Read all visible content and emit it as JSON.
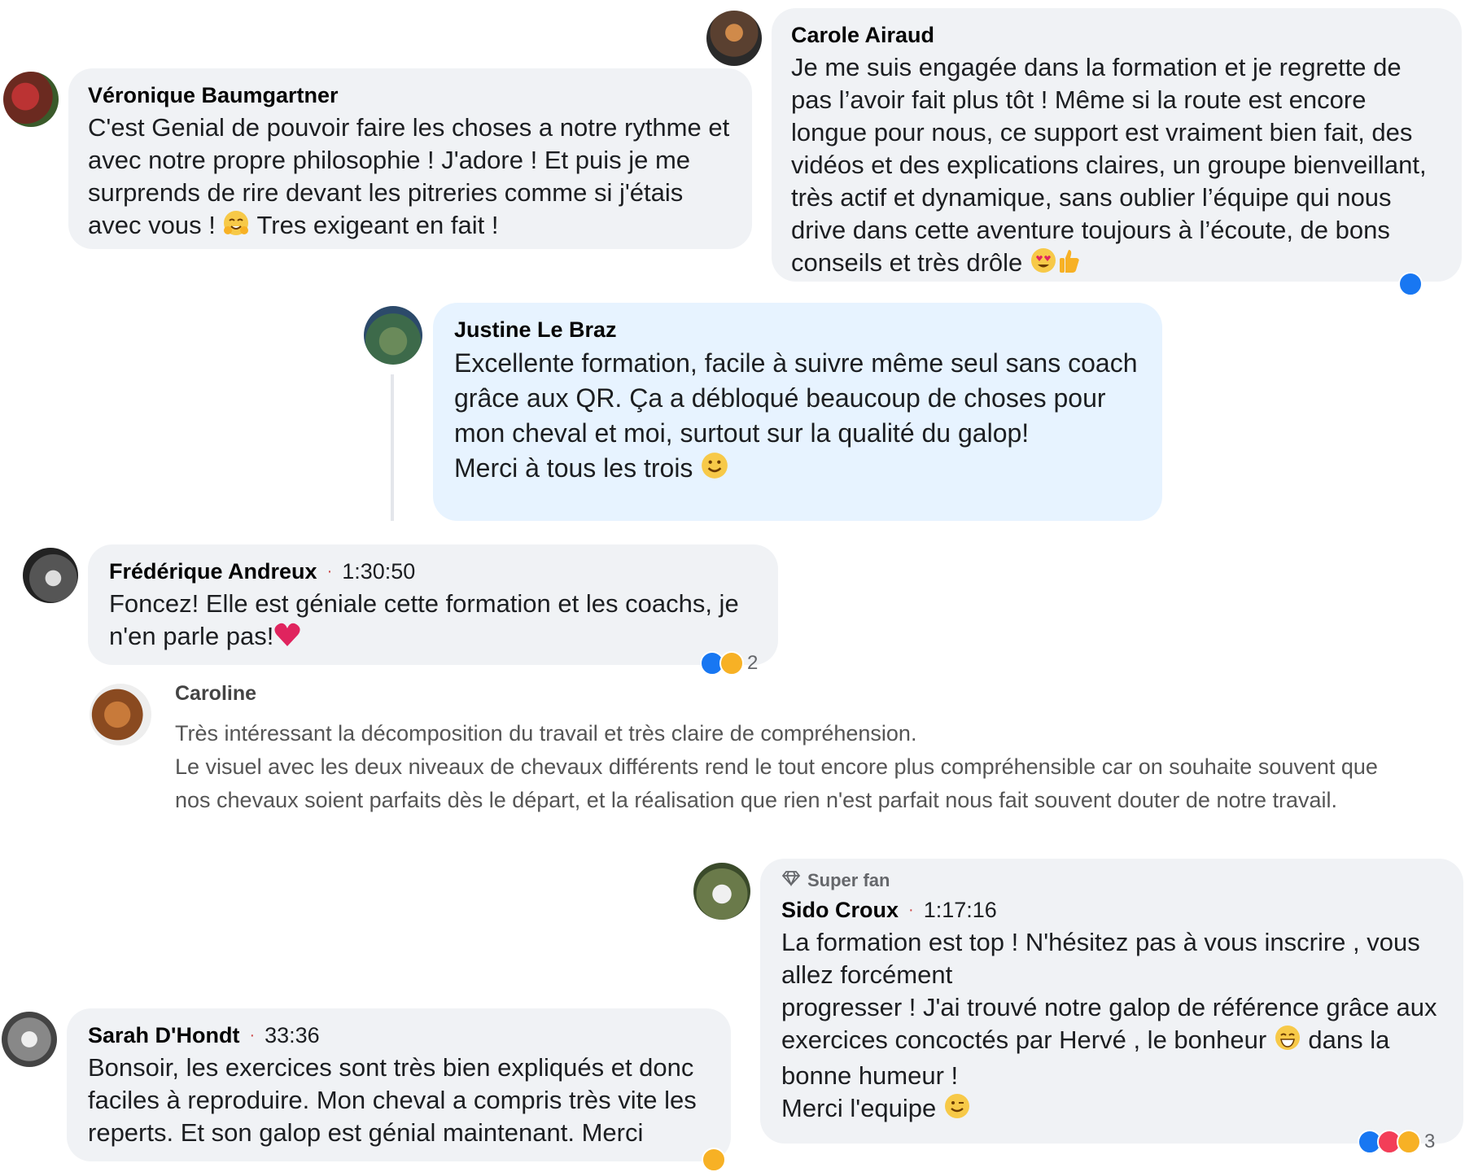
{
  "comments": [
    {
      "author": "Véronique Baumgartner",
      "text": "C'est Genial de pouvoir faire les choses a notre rythme et avec notre propre philosophie ! J'adore ! Et puis je me surprends de rire devant les pitreries comme si j'étais avec vous ! ",
      "text_end": " Tres exigeant en fait !",
      "emoji": "hugging-face"
    },
    {
      "author": "Carole Airaud",
      "text": "Je me suis engagée dans la formation et je regrette de pas l’avoir fait plus tôt ! Même si la route est encore longue pour nous, ce support est vraiment bien fait, des vidéos et des explications claires, un groupe bienveillant, très actif et dynamique, sans oublier l’équipe qui nous drive dans cette aventure toujours à l’écoute, de bons conseils et très drôle ",
      "emoji": "heart-eyes, thumbs-up"
    },
    {
      "author": "Justine Le Braz",
      "text": "Excellente formation, facile à suivre même seul sans coach grâce aux QR. Ça a débloqué beaucoup de choses pour mon cheval et moi, surtout sur la qualité du galop!",
      "text2": "Merci à tous les trois ",
      "emoji": "smile"
    },
    {
      "author": "Frédérique Andreux",
      "time": "1:30:50",
      "text": "Foncez! Elle est géniale cette formation et les coachs, je n'en parle pas!",
      "emoji": "red-heart",
      "reactions": "2"
    },
    {
      "author": "Caroline",
      "text": "Très intéressant la décomposition du travail et très claire de compréhension.",
      "text2": "Le visuel avec les deux niveaux de chevaux différents rend le tout encore plus compréhensible car on souhaite souvent que nos chevaux soient parfaits dès le départ, et la réalisation que rien n'est parfait nous fait souvent douter de notre travail."
    },
    {
      "badge": "Super fan",
      "author": "Sido Croux",
      "time": "1:17:16",
      "text": "La formation est top ! N'hésitez pas à vous inscrire , vous allez forcément",
      "text2": "progresser ! J'ai trouvé notre galop de référence grâce aux exercices concoctés par Hervé , le bonheur ",
      "text2_end": " dans la bonne humeur !",
      "text3": "Merci l'equipe ",
      "emoji": "grin, wink",
      "reactions": "3"
    },
    {
      "author": "Sarah D'Hondt",
      "time": "33:36",
      "text": "Bonsoir, les exercices sont très bien expliqués et donc faciles à reproduire. Mon cheval a compris très vite les reperts. Et son galop est génial maintenant. Merci"
    }
  ],
  "colors": {
    "bubble": "#f0f2f5",
    "bubble_highlight": "#e7f3ff",
    "like": "#1877f2",
    "love": "#f33e58",
    "care": "#f7b125"
  }
}
